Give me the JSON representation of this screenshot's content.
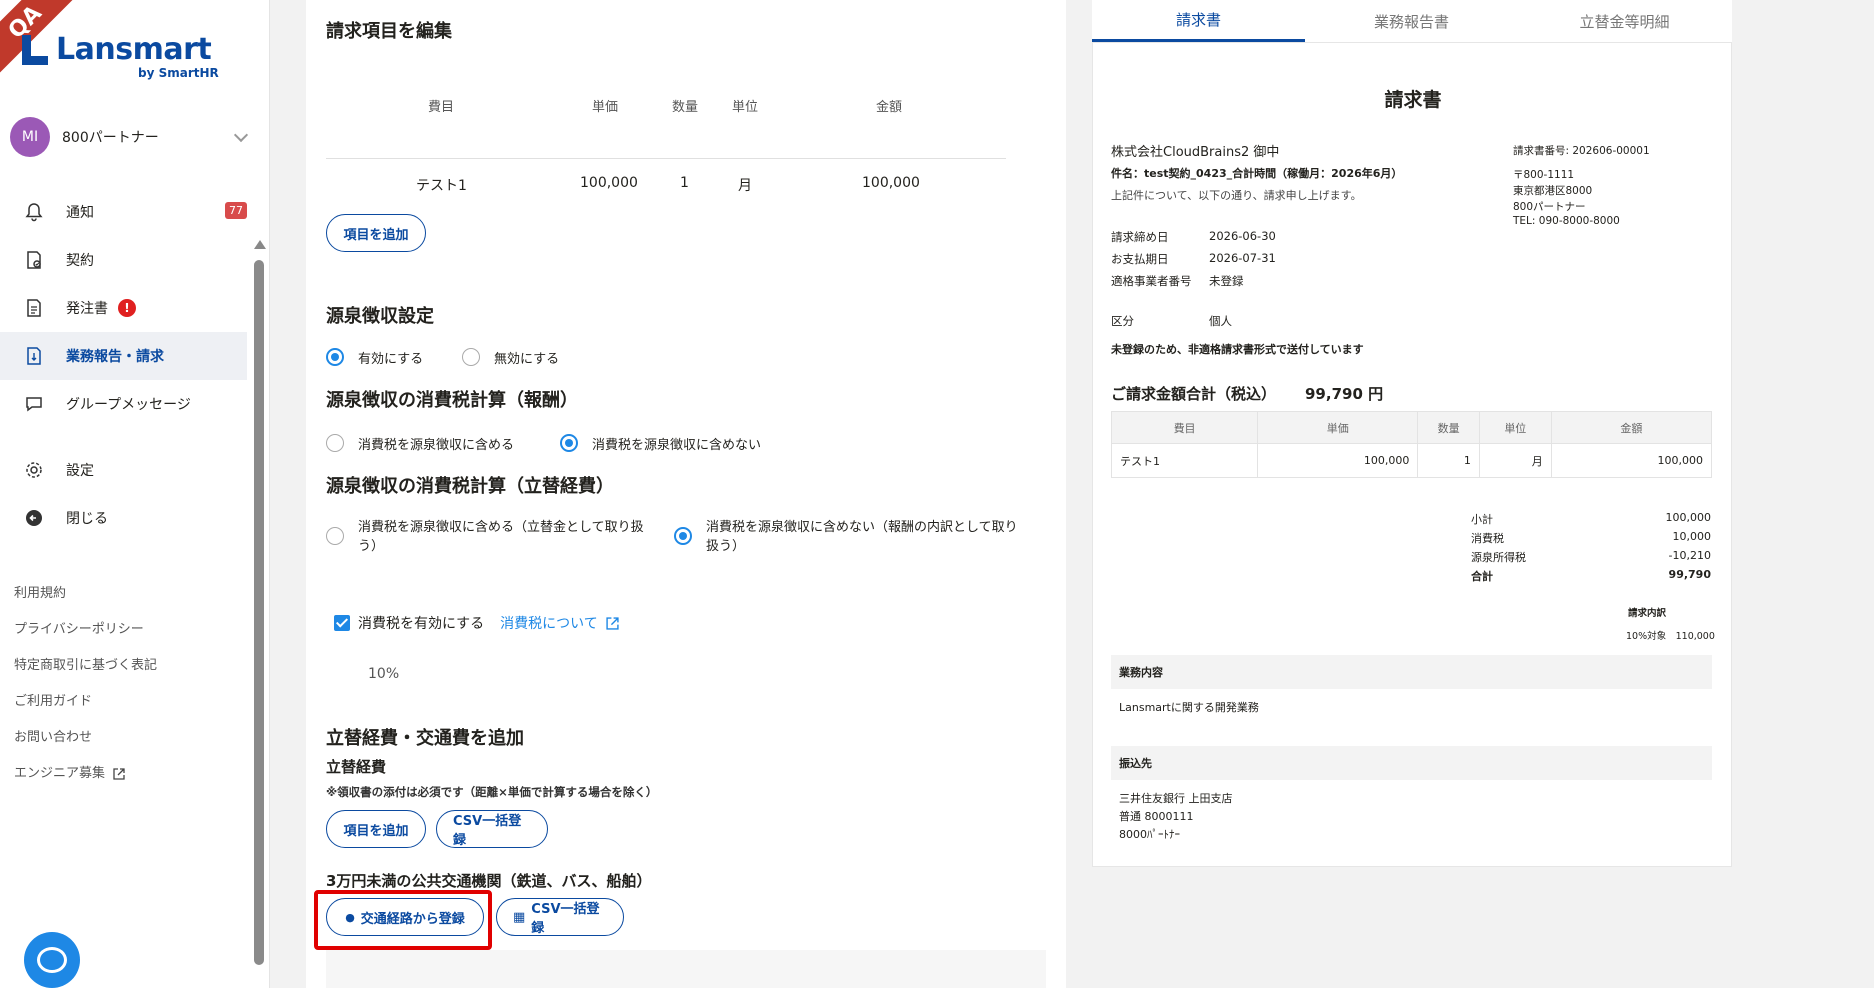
{
  "sidebar": {
    "ribbon": "QA",
    "logo": "Lansmart",
    "logo_sub": "by SmartHR",
    "account": {
      "avatar": "MI",
      "name": "800パートナー"
    },
    "nav": [
      {
        "label": "通知",
        "icon": "bell-icon",
        "badge": "77"
      },
      {
        "label": "契約",
        "icon": "contract-icon"
      },
      {
        "label": "発注書",
        "icon": "document-icon",
        "alert": "!"
      },
      {
        "label": "業務報告・請求",
        "icon": "invoice-icon",
        "active": true
      },
      {
        "label": "グループメッセージ",
        "icon": "chat-icon"
      },
      {
        "label": "設定",
        "icon": "gear-icon"
      },
      {
        "label": "閉じる",
        "icon": "arrow-left-circle-icon"
      }
    ],
    "footer_links": [
      "利用規約",
      "プライバシーポリシー",
      "特定商取引に基づく表記",
      "ご利用ガイド",
      "お問い合わせ",
      "エンジニア募集"
    ]
  },
  "form": {
    "edit_title": "請求項目を編集",
    "columns": [
      "費目",
      "単価",
      "数量",
      "単位",
      "金額"
    ],
    "row": {
      "item": "テスト1",
      "price": "100,000",
      "qty": "1",
      "unit": "月",
      "amount": "100,000"
    },
    "add_item": "項目を追加",
    "withholding_title": "源泉徴収設定",
    "withholding_on": "有効にする",
    "withholding_off": "無効にする",
    "tax_reward_title": "源泉徴収の消費税計算（報酬）",
    "tax_reward_include": "消費税を源泉徴収に含める",
    "tax_reward_exclude": "消費税を源泉徴収に含めない",
    "tax_expense_title": "源泉徴収の消費税計算（立替経費）",
    "tax_expense_include": "消費税を源泉徴収に含める（立替金として取り扱う）",
    "tax_expense_exclude": "消費税を源泉徴収に含めない（報酬の内訳として取り扱う）",
    "tax_enable": "消費税を有効にする",
    "tax_link": "消費税について",
    "tax_rate": "10%",
    "expense_title": "立替経費・交通費を追加",
    "expense_sub": "立替経費",
    "expense_note": "※領収書の添付は必須です（距離×単価で計算する場合を除く）",
    "expense_add": "項目を追加",
    "expense_csv": "CSV一括登録",
    "transit_title": "3万円未満の公共交通機関（鉄道、バス、船舶）",
    "transit_route": "交通経路から登録",
    "transit_csv": "CSV一括登録"
  },
  "preview": {
    "tabs": [
      "請求書",
      "業務報告書",
      "立替金等明細"
    ],
    "title": "請求書",
    "client": "株式会社CloudBrains2 御中",
    "subject": "件名：test契約_0423_合計時間（稼働月：2026年6月）",
    "greeting": "上記件について、以下の通り、請求申し上げます。",
    "invoice_no": "請求書番号: 202606-00001",
    "postal": "〒800-1111",
    "address": "東京都港区8000",
    "sender": "800パートナー",
    "tel": "TEL: 090-8000-8000",
    "meta": [
      {
        "k": "請求締め日",
        "v": "2026-06-30"
      },
      {
        "k": "お支払期日",
        "v": "2026-07-31"
      },
      {
        "k": "適格事業者番号",
        "v": "未登録"
      },
      {
        "k": "区分",
        "v": "個人"
      }
    ],
    "notice": "未登録のため、非適格請求書形式で送付しています",
    "total_label": "ご請求金額合計（税込）",
    "total_value": "99,790 円",
    "columns": [
      "費目",
      "単価",
      "数量",
      "単位",
      "金額"
    ],
    "row": {
      "item": "テスト1",
      "price": "100,000",
      "qty": "1",
      "unit": "月",
      "amount": "100,000"
    },
    "summary": [
      {
        "k": "小計",
        "v": "100,000"
      },
      {
        "k": "消費税",
        "v": "10,000"
      },
      {
        "k": "源泉所得税",
        "v": "-10,210"
      },
      {
        "k": "合計",
        "v": "99,790"
      }
    ],
    "tax_breakdown_title": "請求内訳",
    "tax_breakdown": "10%対象　110,000",
    "work_title": "業務内容",
    "work_text": "Lansmartに関する開発業務",
    "bank_title": "振込先",
    "bank_lines": [
      "三井住友銀行 上田支店",
      "普通 8000111",
      "8000ﾊﾟｰﾄﾅｰ"
    ]
  }
}
